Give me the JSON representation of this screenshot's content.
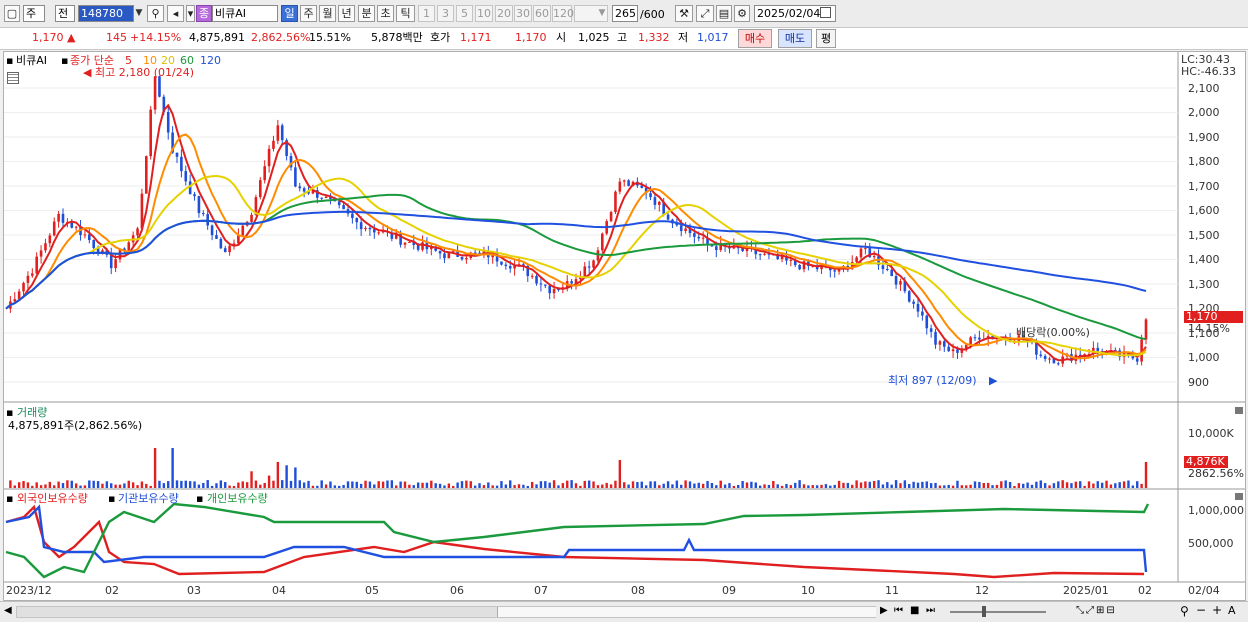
{
  "toolbar": {
    "type_label": "주",
    "range_label": "전",
    "code": "148780",
    "name_badge": "종",
    "name": "비큐AI",
    "periods": [
      "일",
      "주",
      "월",
      "년",
      "분",
      "초",
      "틱"
    ],
    "intervals": [
      "1",
      "3",
      "5",
      "10",
      "20",
      "30",
      "60",
      "120"
    ],
    "count": "265",
    "count_max": "/600",
    "date": "2025/02/04"
  },
  "info": {
    "price": "1,170",
    "change": "145",
    "change_pct": "+14.15%",
    "volume": "4,875,891",
    "volume_ratio": "2,862.56%",
    "turnover_rate": "15.51%",
    "amount": "5,878백만",
    "quote_label": "호가",
    "ask": "1,171",
    "bid": "1,170",
    "open_label": "시",
    "open": "1,025",
    "high_label": "고",
    "high": "1,332",
    "low_label": "저",
    "low": "1,017",
    "buy_label": "매수",
    "sell_label": "매도",
    "avg_label": "평"
  },
  "price_panel": {
    "title": "비큐AI",
    "legend_prefix": "종가 단순",
    "ma": [
      "5",
      "10",
      "20",
      "60",
      "120"
    ],
    "ma_colors": [
      "#e02020",
      "#ff8c00",
      "#e6d200",
      "#1a9a3c",
      "#2050e0"
    ],
    "high_note": "최고 2,180 (01/24)",
    "low_note": "최저 897 (12/09)",
    "dividend_note": "배당락(0.00%)",
    "lc": "LC:30.43",
    "hc": "HC:-46.33",
    "y_ticks": [
      "2,100",
      "2,000",
      "1,900",
      "1,800",
      "1,700",
      "1,600",
      "1,500",
      "1,400",
      "1,300",
      "1,200",
      "1,100",
      "1,000",
      "900"
    ],
    "last_price": "1,170",
    "last_pct": "14.15%"
  },
  "volume_panel": {
    "title": "거래량",
    "value_note": "4,875,891주(2,862.56%)",
    "y_tick": "10,000K",
    "last_value": "4,876K",
    "last_pct": "2862.56%"
  },
  "holding_panel": {
    "legends": [
      "외국인보유수량",
      "기관보유수량",
      "개인보유수량"
    ],
    "legend_colors": [
      "#e02020",
      "#2050e0",
      "#1a9a3c"
    ],
    "y_ticks": [
      "1,000,000",
      "500,000"
    ]
  },
  "x_axis": [
    "2023/12",
    "02",
    "03",
    "04",
    "05",
    "06",
    "07",
    "08",
    "09",
    "10",
    "11",
    "12",
    "2025/01",
    "02"
  ],
  "x_axis_right": "02/04",
  "colors": {
    "up": "#e21f1f",
    "down": "#1f4ed8",
    "highlight": "#e21f1f"
  }
}
